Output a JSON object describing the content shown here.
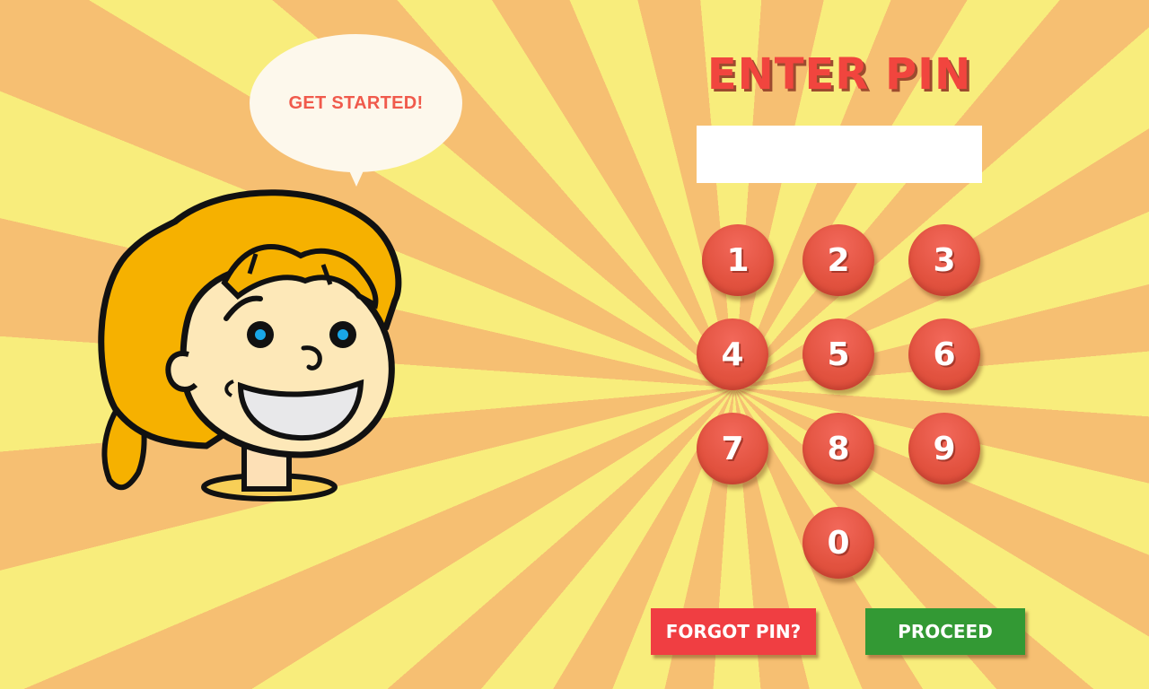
{
  "bubble": {
    "text": "GET STARTED!"
  },
  "title": "ENTER PIN",
  "pin_field": {
    "value": ""
  },
  "keypad": {
    "k1": "1",
    "k2": "2",
    "k3": "3",
    "k4": "4",
    "k5": "5",
    "k6": "6",
    "k7": "7",
    "k8": "8",
    "k9": "9",
    "k0": "0"
  },
  "buttons": {
    "forgot": "FORGOT PIN?",
    "proceed": "PROCEED"
  },
  "colors": {
    "background_ray_light": "#f8ed7c",
    "background_ray_dark": "#f6bf72",
    "title": "#f1453e",
    "key": "#e2523f",
    "forgot_button": "#f03e42",
    "proceed_button": "#339934"
  },
  "icons": {
    "mascot": "cartoon-girl-icon"
  }
}
